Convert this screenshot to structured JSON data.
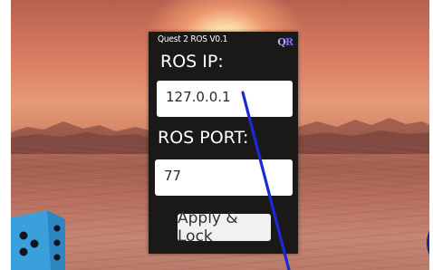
{
  "panel": {
    "title": "Quest 2 ROS V0.1",
    "logo_q": "Q",
    "logo_r": "R",
    "ip_label": "ROS IP:",
    "ip_value": "127.0.0.1",
    "port_label": "ROS PORT:",
    "port_value": "77",
    "apply_label": "Apply & Lock"
  },
  "colors": {
    "panel_bg": "#1b1818",
    "ray": "#1a2bd6",
    "dice": "#3fa8e0",
    "logo": "#b9a4ff"
  }
}
